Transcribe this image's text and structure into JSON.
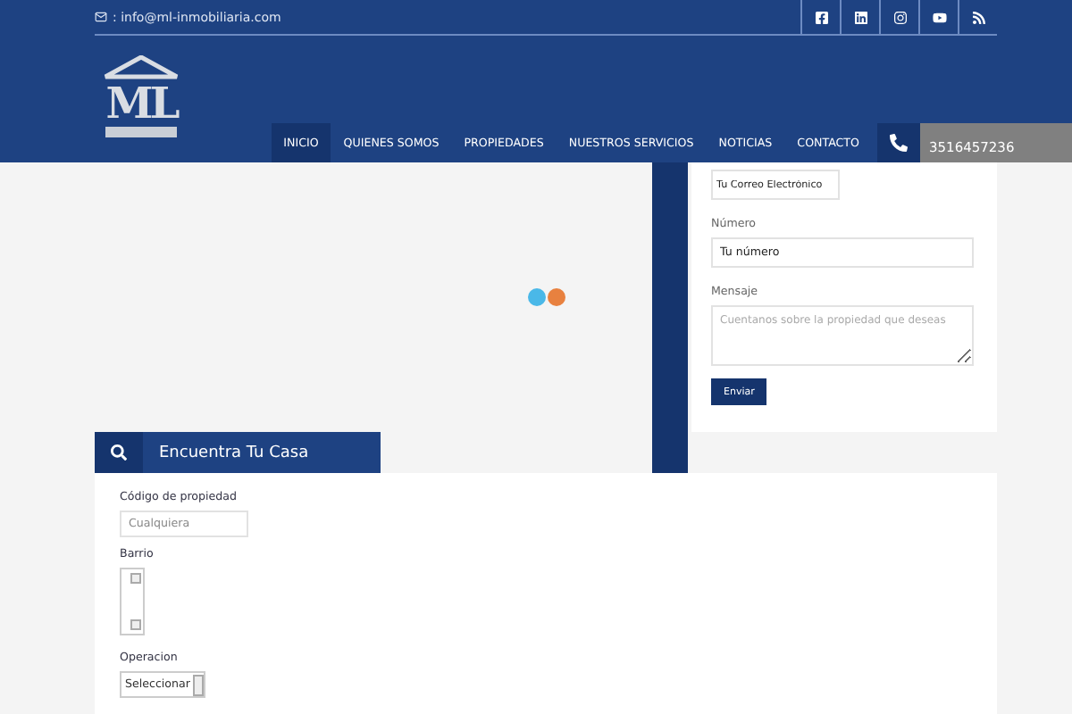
{
  "topbar": {
    "email": ": info@ml-inmobiliaria.com"
  },
  "logo": {
    "text": "ML"
  },
  "nav": [
    {
      "label": "INICIO",
      "selected": true
    },
    {
      "label": "QUIENES SOMOS",
      "selected": false
    },
    {
      "label": "PROPIEDADES",
      "selected": false
    },
    {
      "label": "NUESTROS SERVICIOS",
      "selected": false
    },
    {
      "label": "NOTICIAS",
      "selected": false
    },
    {
      "label": "CONTACTO",
      "selected": false
    }
  ],
  "phone": "3516457236",
  "contact_form": {
    "email_value": "Tu Correo Electrónico",
    "number_label": "Número",
    "number_value": "Tu número",
    "message_label": "Mensaje",
    "message_placeholder": "Cuentanos sobre la propiedad que deseas",
    "submit": "Enviar"
  },
  "search": {
    "title": "Encuentra Tu Casa",
    "code_label": "Código de propiedad",
    "code_placeholder": "Cualquiera",
    "barrio_label": "Barrio",
    "operacion_label": "Operacion",
    "operacion_value": "Seleccionar"
  }
}
